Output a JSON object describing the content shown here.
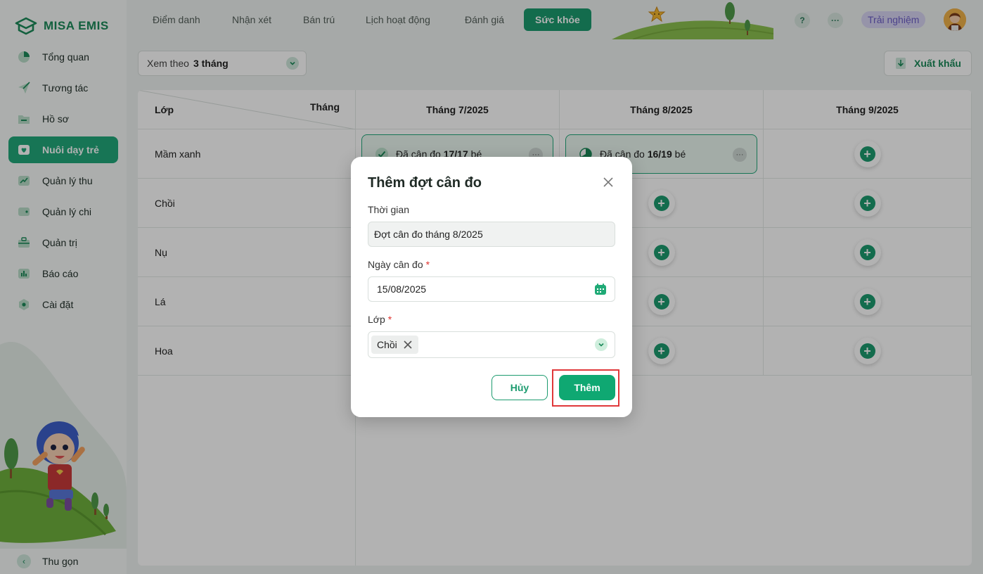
{
  "app": {
    "brand": "MISA EMIS"
  },
  "sidebar": {
    "items": [
      {
        "label": "Tổng quan",
        "icon": "pie-chart-icon"
      },
      {
        "label": "Tương tác",
        "icon": "paper-plane-icon"
      },
      {
        "label": "Hồ sơ",
        "icon": "folder-icon"
      },
      {
        "label": "Nuôi dạy trẻ",
        "icon": "heart-icon",
        "active": true
      },
      {
        "label": "Quản lý thu",
        "icon": "trend-up-icon"
      },
      {
        "label": "Quản lý chi",
        "icon": "wallet-icon"
      },
      {
        "label": "Quản trị",
        "icon": "briefcase-icon"
      },
      {
        "label": "Báo cáo",
        "icon": "bar-chart-icon"
      },
      {
        "label": "Cài đặt",
        "icon": "gear-icon"
      }
    ],
    "collapse_label": "Thu gọn"
  },
  "topbar": {
    "tabs": [
      {
        "label": "Điểm danh"
      },
      {
        "label": "Nhận xét"
      },
      {
        "label": "Bán trú"
      },
      {
        "label": "Lịch hoạt động"
      },
      {
        "label": "Đánh giá"
      },
      {
        "label": "Sức khỏe",
        "active": true
      }
    ],
    "help": "?",
    "more": "···",
    "trial_label": "Trải nghiệm"
  },
  "filter": {
    "label": "Xem theo",
    "value": "3 tháng"
  },
  "export_label": "Xuất khẩu",
  "table": {
    "corner_left": "Lớp",
    "corner_right": "Tháng",
    "months": [
      "Tháng 7/2025",
      "Tháng 8/2025",
      "Tháng 9/2025"
    ],
    "classes": [
      "Mầm xanh",
      "Chồi",
      "Nụ",
      "Lá",
      "Hoa"
    ],
    "cards": [
      {
        "prefix": "Đã cân đo",
        "count": "17/17",
        "suffix": "bé"
      },
      {
        "prefix": "Đã cân đo",
        "count": "16/19",
        "suffix": "bé"
      }
    ],
    "more": "···",
    "add": "+"
  },
  "modal": {
    "title": "Thêm đợt cân đo",
    "time_label": "Thời gian",
    "time_value": "Đợt cân đo tháng 8/2025",
    "date_label": "Ngày cân đo",
    "date_value": "15/08/2025",
    "class_label": "Lớp",
    "class_chip": "Chồi",
    "required_mark": "*",
    "cancel_label": "Hủy",
    "add_label": "Thêm"
  },
  "colors": {
    "primary": "#1c9b6f",
    "accent_border": "#e0383a",
    "trial": "#6d5fc8"
  }
}
